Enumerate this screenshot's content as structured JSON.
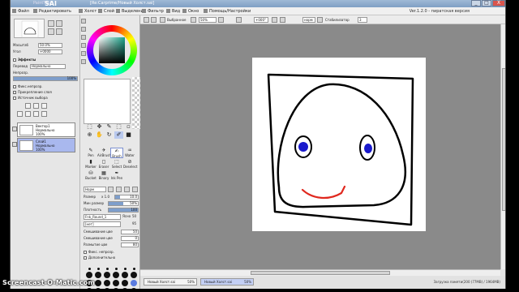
{
  "app": {
    "logo": "SAI",
    "logo_sub": "PaintTool",
    "window_title": "[Re:Carprime/Новый Холст.sai]",
    "minimize": "_",
    "maximize": "□",
    "close": "X"
  },
  "menu": {
    "items": [
      "Файл",
      "Редактировать",
      "Холст",
      "Слой",
      "Выделение",
      "Фильтр",
      "Вид",
      "Окно",
      "Помощь/Настройки"
    ],
    "right_text": "Ver.1.2.0 - пиратская версия"
  },
  "toolbar": {
    "selection_label": "Выбранное",
    "zoom": "50%",
    "angle": "+000°",
    "mode": "норм",
    "stabilizer_label": "Стабилизатор",
    "stabilizer_value": "3"
  },
  "navigator": {
    "zoom_label": "Масштаб",
    "zoom_value": "50.0%",
    "angle_label": "Угол",
    "angle_value": "+0000"
  },
  "layer_panel": {
    "effects_label": "Эффекты",
    "blend_label": "Перевод",
    "blend_value": "Нормально",
    "opacity_label": "Непрозр.",
    "opacity_value": "100%",
    "opacity_fraction": 1.0,
    "options": [
      "Фикс.непрозр.",
      "Прикрепление слоя",
      "Источник выбора"
    ],
    "layers": [
      {
        "name": "Вектор1",
        "mode": "Нормально",
        "opacity": "100%",
        "selected": false
      },
      {
        "name": "Слой1",
        "mode": "Нормально",
        "opacity": "100%",
        "selected": true
      }
    ]
  },
  "tools": {
    "row_glyphs": [
      "⬚",
      "✥",
      "✎",
      "⬚",
      "▫",
      "⊕",
      "✋",
      "↻",
      "✐",
      "■"
    ],
    "brushes": [
      {
        "label": "Pen",
        "glyph": "✎",
        "selected": false
      },
      {
        "label": "AirBrush",
        "glyph": "✈",
        "selected": false
      },
      {
        "label": "Brush",
        "glyph": "✍",
        "selected": true
      },
      {
        "label": "Water",
        "glyph": "♒",
        "selected": false
      },
      {
        "label": "Marker",
        "glyph": "▮",
        "selected": false
      },
      {
        "label": "Eraser",
        "glyph": "◻",
        "selected": false
      },
      {
        "label": "Select",
        "glyph": "⬚",
        "selected": false
      },
      {
        "label": "Deselect",
        "glyph": "⊘",
        "selected": false
      },
      {
        "label": "Bucket",
        "glyph": "⛁",
        "selected": false
      },
      {
        "label": "Binary",
        "glyph": "▦",
        "selected": false
      },
      {
        "label": "Ink Pen",
        "glyph": "✒",
        "selected": false
      },
      {
        "label": "",
        "glyph": "",
        "selected": false
      }
    ]
  },
  "brush_settings": {
    "mode": "Норм",
    "size_label": "Размер",
    "size_mult": "x 1.0",
    "size_value": "10.0",
    "size_fraction": 0.2,
    "min_size_label": "Мин размер",
    "min_size_value": "50%",
    "min_size_fraction": 0.5,
    "density_label": "Плотность",
    "density_value": "100",
    "density_fraction": 1.0,
    "shape_value": "Fnk_Round_1",
    "shape_strength_label": "Ясно",
    "shape_strength_value": "50",
    "texture_value": "[нет]",
    "texture_strength_value": "95",
    "blending_label": "Смешивание цве",
    "blending_value": "50",
    "dilution_label": "Смешивание цве",
    "dilution_value": "0",
    "persistence_label": "Размытие цве",
    "persistence_value": "80",
    "keep_opacity_label": "Фикс. непрозр.",
    "advanced_label": "Дополнительно",
    "preset_sizes": [
      "",
      "",
      "",
      "",
      "",
      "",
      "",
      "",
      "",
      "",
      "",
      "",
      "",
      "",
      "",
      "",
      "",
      "",
      "",
      "",
      "",
      "",
      "",
      "",
      "",
      "",
      "",
      "",
      "",
      ""
    ]
  },
  "documents": [
    {
      "name": "Новый Холст.sai",
      "zoom": "50%",
      "active": false
    },
    {
      "name": "Новый Холст.sai",
      "zoom": "50%",
      "active": true
    }
  ],
  "status": {
    "text": "Загрузка памяти(200 (77MB) / 1964MB)"
  },
  "drawing": {
    "stroke_color": "#000000",
    "eye_color": "#1a1acc",
    "mouth_color": "#e0281e"
  },
  "watermark": "Screencast-O-Matic.com"
}
